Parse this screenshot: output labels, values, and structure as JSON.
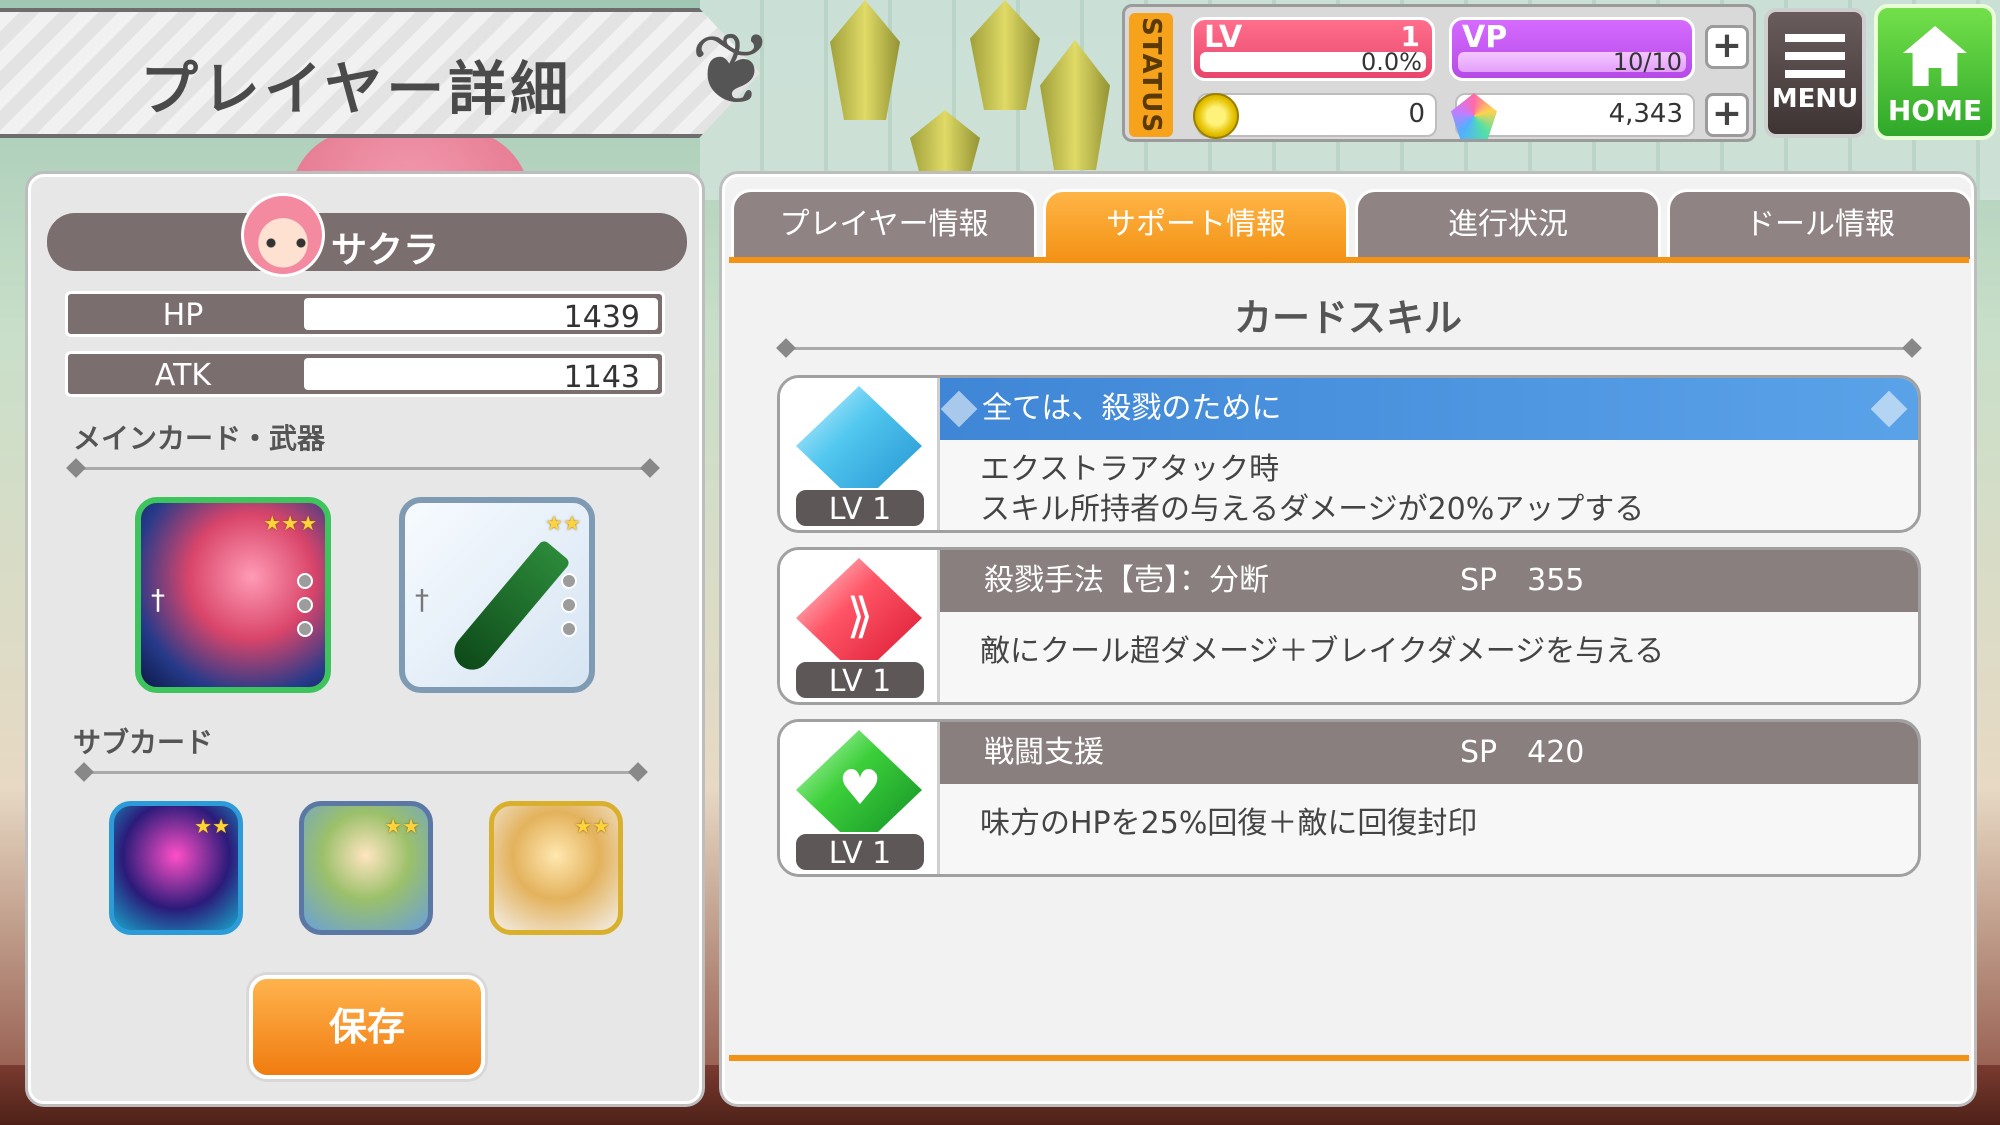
{
  "header": {
    "title": "プレイヤー詳細"
  },
  "status": {
    "tab_label": "STATUS",
    "lv": {
      "label": "LV",
      "value": "1",
      "percent": "0.0%"
    },
    "vp": {
      "label": "VP",
      "value": "10/10"
    },
    "coins": "0",
    "gems": "4,343",
    "plus": "+"
  },
  "nav": {
    "menu": "MENU",
    "home": "HOME"
  },
  "player": {
    "name": "サクラ",
    "stats": [
      {
        "label": "HP",
        "value": "1439"
      },
      {
        "label": "ATK",
        "value": "1143"
      }
    ],
    "main_section": "メインカード・武器",
    "sub_section": "サブカード",
    "save": "保存"
  },
  "tabs": [
    "プレイヤー情報",
    "サポート情報",
    "進行状況",
    "ドール情報"
  ],
  "active_tab": 1,
  "skills_title": "カードスキル",
  "skills": [
    {
      "name": "全ては、殺戮のために",
      "sp": "",
      "level": "LV 1",
      "desc1": "エクストラアタック時",
      "desc2": "スキル所持者の与えるダメージが20%アップする",
      "color": "#52c7ef"
    },
    {
      "name": "殺戮手法【壱】：分断",
      "sp": "SP　355",
      "level": "LV 1",
      "desc1": "敵にクール超ダメージ＋ブレイクダメージを与える",
      "desc2": "",
      "color": "#ff5566"
    },
    {
      "name": "戦闘支援",
      "sp": "SP　420",
      "level": "LV 1",
      "desc1": "味方のHPを25%回復＋敵に回復封印",
      "desc2": "",
      "color": "#3ccf3a"
    }
  ]
}
